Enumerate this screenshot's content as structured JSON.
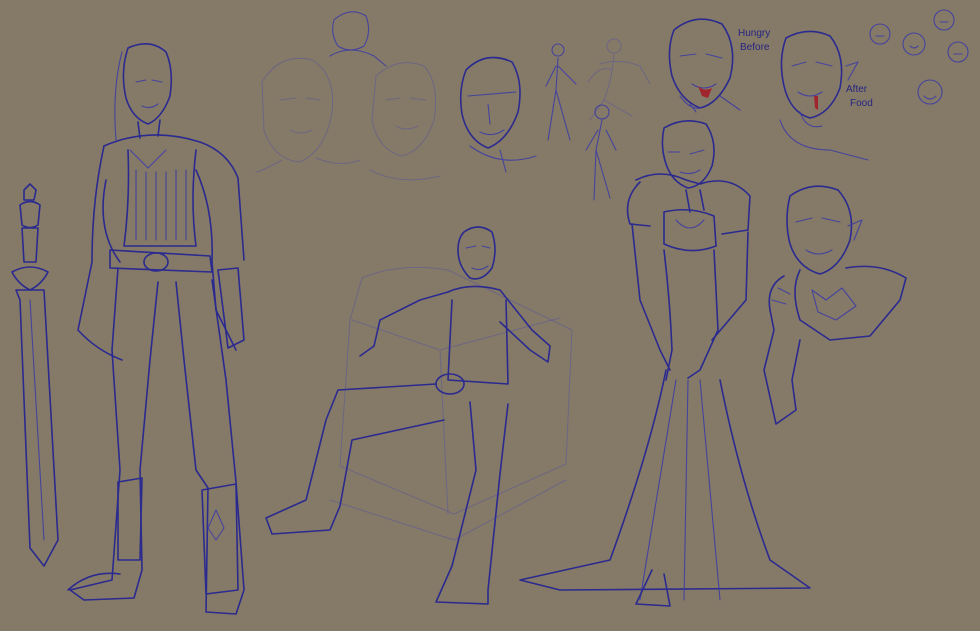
{
  "artwork": {
    "background_color": "#857a68",
    "ink_color": "#2b2a8f",
    "accent_color": "#a0262e",
    "annotations": {
      "hungry_before_line1": "Hungry",
      "hungry_before_line2": "Before",
      "after_food_line1": "After",
      "after_food_line2": "Food"
    }
  }
}
